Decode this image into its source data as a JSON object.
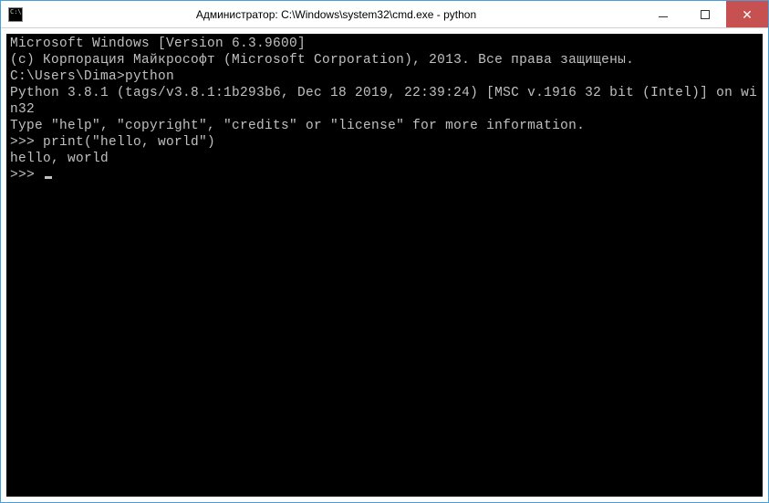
{
  "window": {
    "title": "Администратор: C:\\Windows\\system32\\cmd.exe - python",
    "icon_text": "C:\\"
  },
  "console": {
    "line1": "Microsoft Windows [Version 6.3.9600]",
    "line2": "(c) Корпорация Майкрософт (Microsoft Corporation), 2013. Все права защищены.",
    "line3": "",
    "line4": "C:\\Users\\Dima>python",
    "line5": "Python 3.8.1 (tags/v3.8.1:1b293b6, Dec 18 2019, 22:39:24) [MSC v.1916 32 bit (Intel)] on win32",
    "line6": "Type \"help\", \"copyright\", \"credits\" or \"license\" for more information.",
    "line7": ">>> print(\"hello, world\")",
    "line8": "hello, world",
    "line9": ">>> "
  }
}
